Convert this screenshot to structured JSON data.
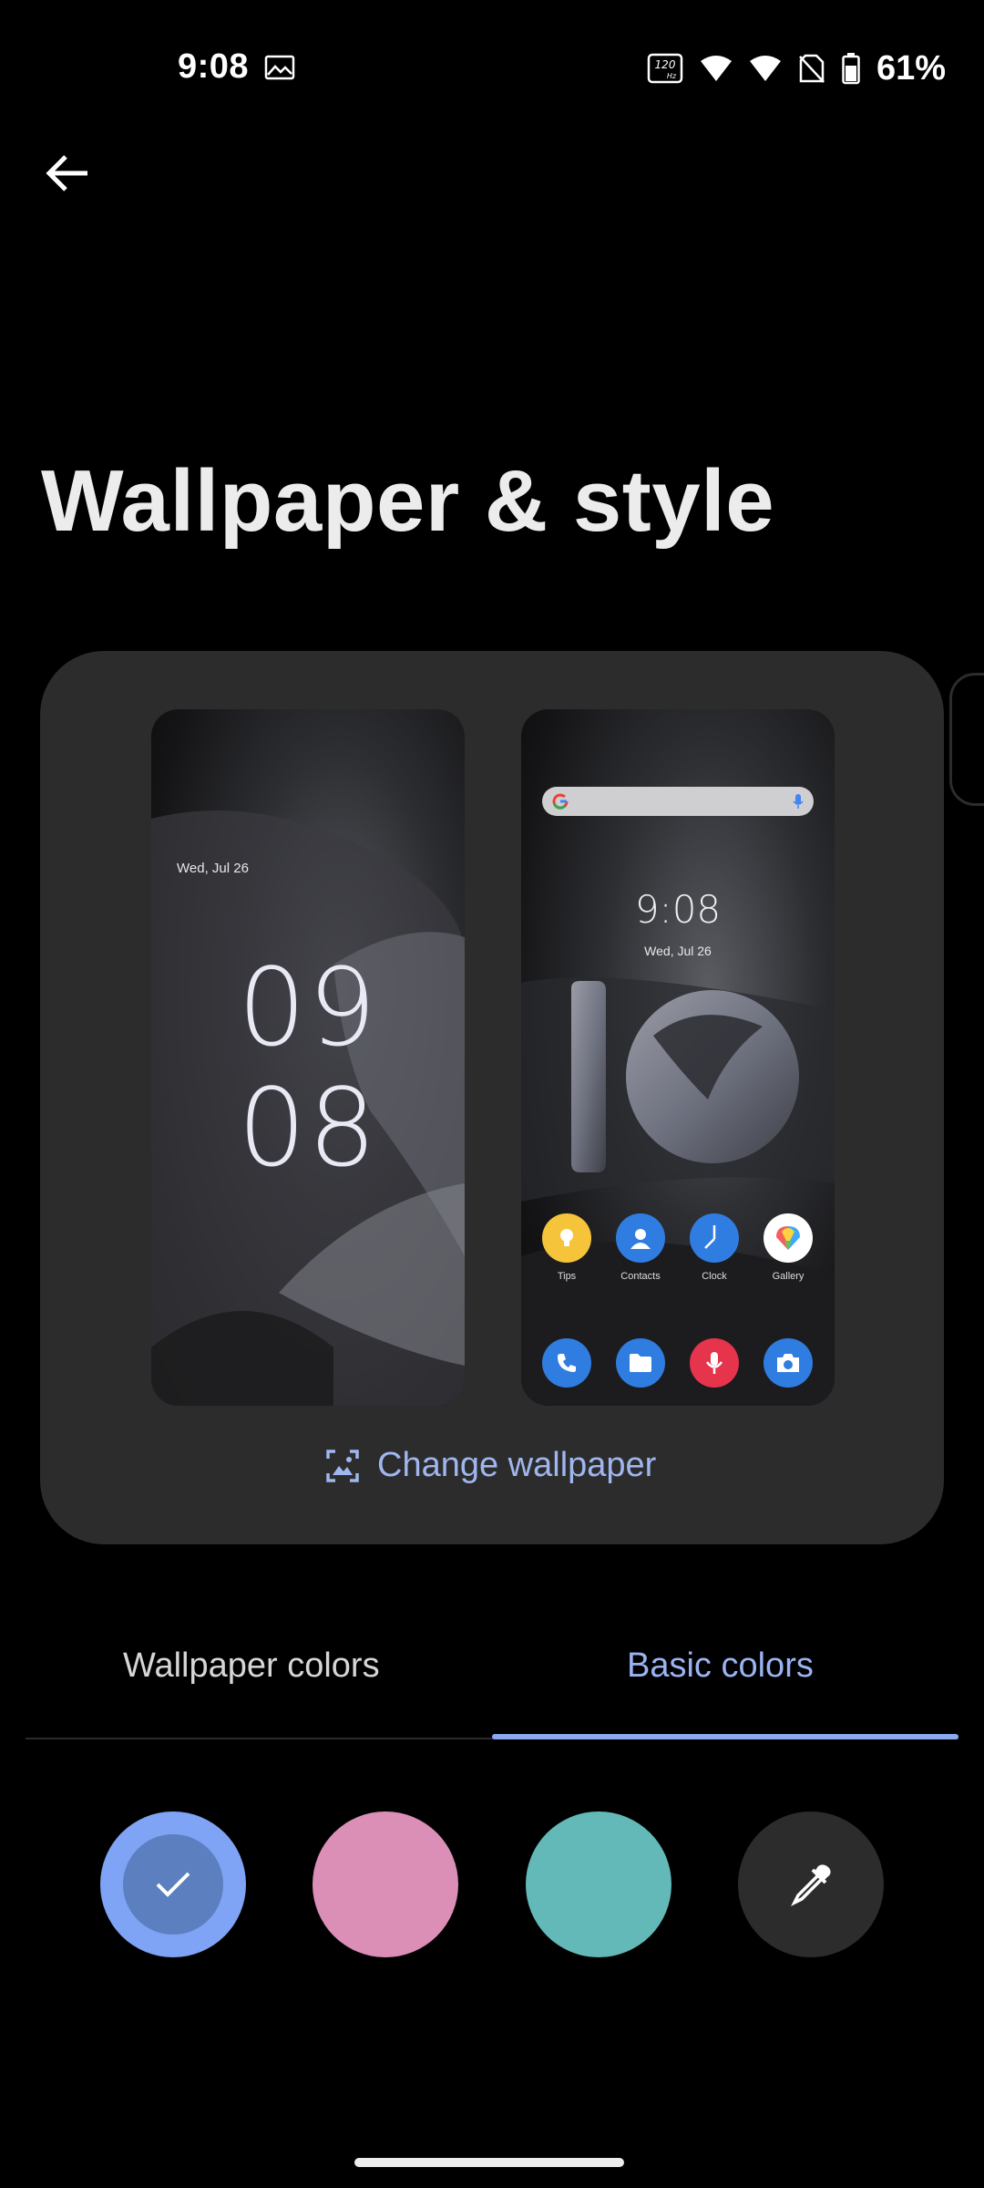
{
  "status_bar": {
    "time": "9:08",
    "battery": "61%",
    "refresh_rate": "120",
    "refresh_unit": "Hz"
  },
  "page": {
    "title": "Wallpaper & style"
  },
  "preview": {
    "lock_screen": {
      "date": "Wed, Jul 26",
      "clock_hour": "09",
      "clock_minute": "08"
    },
    "home_screen": {
      "clock": "9:08",
      "date": "Wed, Jul 26",
      "apps": [
        {
          "label": "Tips",
          "icon": "lightbulb-icon",
          "color": "#f5c43a"
        },
        {
          "label": "Contacts",
          "icon": "person-icon",
          "color": "#2f7de1"
        },
        {
          "label": "Clock",
          "icon": "clock-icon",
          "color": "#2f7de1"
        },
        {
          "label": "Gallery",
          "icon": "gallery-pinwheel-icon",
          "color": "#ffffff"
        }
      ],
      "dock": [
        {
          "icon": "phone-icon",
          "color": "#2f7de1"
        },
        {
          "icon": "folder-icon",
          "color": "#2f7de1"
        },
        {
          "icon": "mic-icon",
          "color": "#e5344c"
        },
        {
          "icon": "camera-icon",
          "color": "#2f7de1"
        }
      ]
    },
    "change_wallpaper_label": "Change wallpaper"
  },
  "tabs": {
    "items": [
      {
        "label": "Wallpaper colors",
        "selected": false
      },
      {
        "label": "Basic colors",
        "selected": true
      }
    ]
  },
  "swatches": [
    {
      "name": "blue",
      "color": "#7fa3f5",
      "selected": true
    },
    {
      "name": "pink",
      "color": "#dc8fb6",
      "selected": false
    },
    {
      "name": "teal",
      "color": "#63b8b8",
      "selected": false
    },
    {
      "name": "custom",
      "color": "#2c2c2c",
      "selected": false
    }
  ],
  "colors": {
    "accent": "#9ab4f2",
    "background": "#000000",
    "card": "#2c2c2c"
  }
}
